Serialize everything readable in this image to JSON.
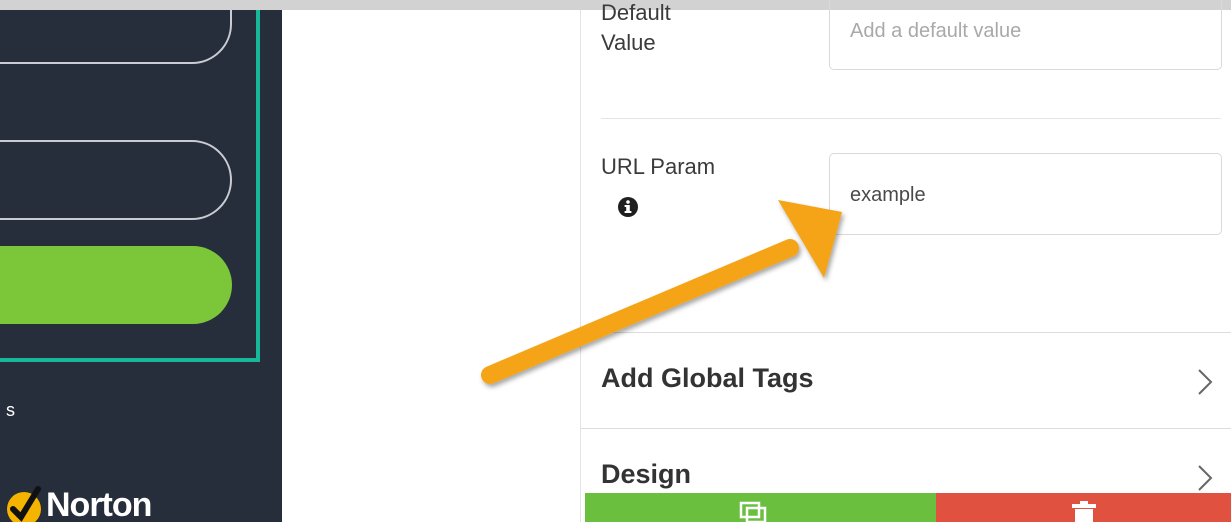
{
  "preview": {
    "fragment_text": "s",
    "logo_text": "Norton"
  },
  "settings": {
    "default_value": {
      "label_line1": "Default",
      "label_line2": "Value",
      "placeholder": "Add a default value"
    },
    "url_param": {
      "label": "URL Param",
      "value": "example"
    },
    "sections": [
      {
        "title": "Add Global Tags"
      },
      {
        "title": "Design"
      }
    ]
  },
  "colors": {
    "preview_bg": "#262d3b",
    "frame_accent": "#17b79a",
    "preview_button": "#7cc639",
    "arrow": "#f4a414",
    "duplicate_button": "#6bbf3f",
    "delete_button": "#e05140"
  }
}
